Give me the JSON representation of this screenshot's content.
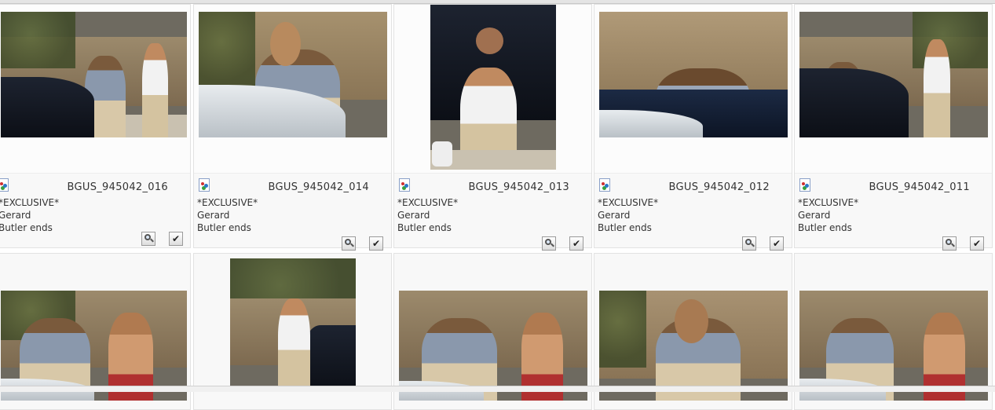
{
  "gallery": {
    "rows": [
      {
        "items": [
          {
            "filename": "BGUS_945042_016",
            "line1": "*EXCLUSIVE*",
            "line2": "Gerard",
            "line3": "Butler ends"
          },
          {
            "filename": "BGUS_945042_014",
            "line1": "*EXCLUSIVE*",
            "line2": "Gerard",
            "line3": "Butler ends"
          },
          {
            "filename": "BGUS_945042_013",
            "line1": "*EXCLUSIVE*",
            "line2": "Gerard",
            "line3": "Butler ends"
          },
          {
            "filename": "BGUS_945042_012",
            "line1": "*EXCLUSIVE*",
            "line2": "Gerard",
            "line3": "Butler ends"
          },
          {
            "filename": "BGUS_945042_011",
            "line1": "*EXCLUSIVE*",
            "line2": "Gerard",
            "line3": "Butler ends"
          }
        ]
      }
    ],
    "actions": {
      "zoom_icon": "magnifier-icon",
      "select_icon": "checkmark-icon",
      "check_glyph": "✔"
    },
    "colors": {
      "card_bg": "#f8f8f8",
      "border": "#e2e2e2",
      "text": "#333333"
    }
  }
}
